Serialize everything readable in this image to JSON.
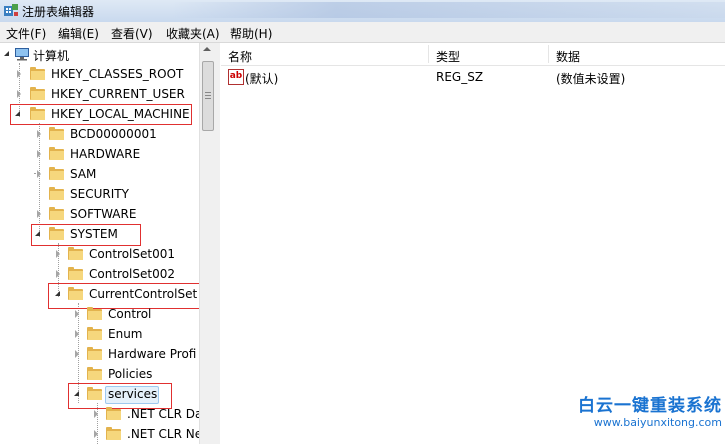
{
  "window": {
    "title": "注册表编辑器"
  },
  "menu": [
    "文件(F)",
    "编辑(E)",
    "查看(V)",
    "收藏夹(A)",
    "帮助(H)"
  ],
  "tree": {
    "root": "计算机",
    "nodes": [
      {
        "label": "HKEY_CLASSES_ROOT"
      },
      {
        "label": "HKEY_CURRENT_USER"
      },
      {
        "label": "HKEY_LOCAL_MACHINE"
      },
      {
        "label": "BCD00000001"
      },
      {
        "label": "HARDWARE"
      },
      {
        "label": "SAM"
      },
      {
        "label": "SECURITY"
      },
      {
        "label": "SOFTWARE"
      },
      {
        "label": "SYSTEM"
      },
      {
        "label": "ControlSet001"
      },
      {
        "label": "ControlSet002"
      },
      {
        "label": "CurrentControlSet"
      },
      {
        "label": "Control"
      },
      {
        "label": "Enum"
      },
      {
        "label": "Hardware Profi"
      },
      {
        "label": "Policies"
      },
      {
        "label": "services"
      },
      {
        "label": ".NET CLR Da"
      },
      {
        "label": ".NET CLR Ne"
      }
    ]
  },
  "list": {
    "columns": [
      "名称",
      "类型",
      "数据"
    ],
    "rows": [
      {
        "name": "(默认)",
        "type": "REG_SZ",
        "data": "(数值未设置)"
      }
    ]
  },
  "watermark": {
    "title": "白云一键重装系统",
    "url": "www.baiyunxitong.com"
  },
  "colors": {
    "highlight": "#e03030",
    "folder": "#f6d77d",
    "watermark": "#1a73d1"
  }
}
